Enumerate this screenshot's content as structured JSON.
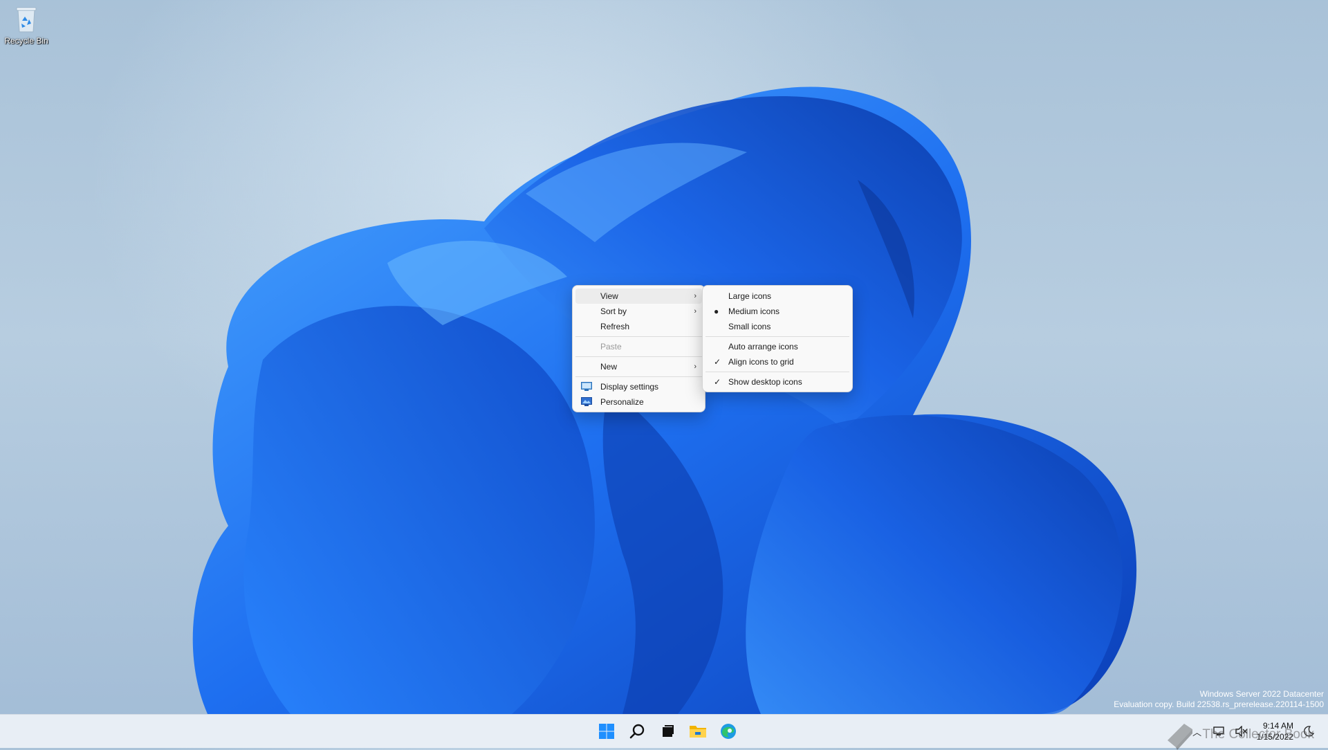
{
  "desktop": {
    "recycle_bin_label": "Recycle Bin"
  },
  "context_menu": {
    "items": [
      {
        "label": "View",
        "has_submenu": true
      },
      {
        "label": "Sort by",
        "has_submenu": true
      },
      {
        "label": "Refresh"
      },
      {
        "label": "Paste",
        "disabled": true
      },
      {
        "label": "New",
        "has_submenu": true
      },
      {
        "label": "Display settings",
        "icon": "display-icon"
      },
      {
        "label": "Personalize",
        "icon": "personalize-icon"
      }
    ]
  },
  "view_submenu": {
    "items": [
      {
        "label": "Large icons"
      },
      {
        "label": "Medium icons",
        "marker": "bullet"
      },
      {
        "label": "Small icons"
      },
      {
        "label": "Auto arrange icons"
      },
      {
        "label": "Align icons to grid",
        "marker": "check"
      },
      {
        "label": "Show desktop icons",
        "marker": "check"
      }
    ]
  },
  "watermark": {
    "line1": "Windows Server 2022 Datacenter",
    "line2": "Evaluation copy. Build 22538.rs_prerelease.220114-1500"
  },
  "taskbar": {
    "icons": [
      "start-icon",
      "search-icon",
      "task-view-icon",
      "file-explorer-icon",
      "edge-icon"
    ],
    "clock_time": "9:14 AM",
    "clock_date": "1/15/2022"
  },
  "overlay_watermark": "The Collector Book",
  "colors": {
    "accent": "#0067c0",
    "wallpaper_blue": "#1a5fe0",
    "menu_bg": "#f9f9f9"
  }
}
